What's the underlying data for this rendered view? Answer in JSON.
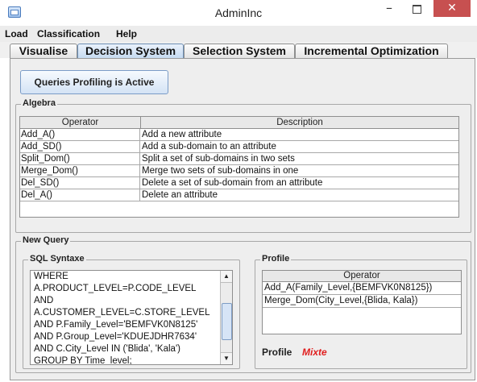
{
  "window": {
    "title": "AdminInc",
    "minimize": "–",
    "close": "✕"
  },
  "menu": {
    "items": [
      "Load",
      "Classification",
      "Help"
    ]
  },
  "tabs": [
    "Visualise",
    "Decision System",
    "Selection System",
    "Incremental Optimization"
  ],
  "active_tab": "Decision System",
  "profiling_button": "Queries Profiling is Active",
  "algebra": {
    "title": "Algebra",
    "columns": [
      "Operator",
      "Description"
    ],
    "rows": [
      [
        "Add_A()",
        "Add a new attribute"
      ],
      [
        "Add_SD()",
        "Add a sub-domain to an attribute"
      ],
      [
        "Split_Dom()",
        "Split a set of sub-domains in two sets"
      ],
      [
        "Merge_Dom()",
        "Merge two sets of sub-domains in one"
      ],
      [
        "Del_SD()",
        "Delete a set of sub-domain from an attribute"
      ],
      [
        "Del_A()",
        "Delete an attribute"
      ]
    ]
  },
  "new_query": {
    "title": "New Query",
    "sql_title": "SQL Syntaxe",
    "sql_lines": [
      "WHERE",
      "A.PRODUCT_LEVEL=P.CODE_LEVEL",
      "AND",
      "A.CUSTOMER_LEVEL=C.STORE_LEVEL",
      "AND P.Family_Level='BEMFVK0N8125'",
      "AND P.Group_Level='KDUEJDHR7634'",
      "AND C.City_Level IN ('Blida', 'Kala')",
      "GROUP BY Time_level;"
    ],
    "profile_title": "Profile",
    "profile_column": "Operator",
    "profile_rows": [
      "Add_A(Family_Level,{BEMFVK0N8125})",
      "Merge_Dom(City_Level,{Blida, Kala})"
    ],
    "profile_label": "Profile",
    "profile_value": "Mixte"
  }
}
